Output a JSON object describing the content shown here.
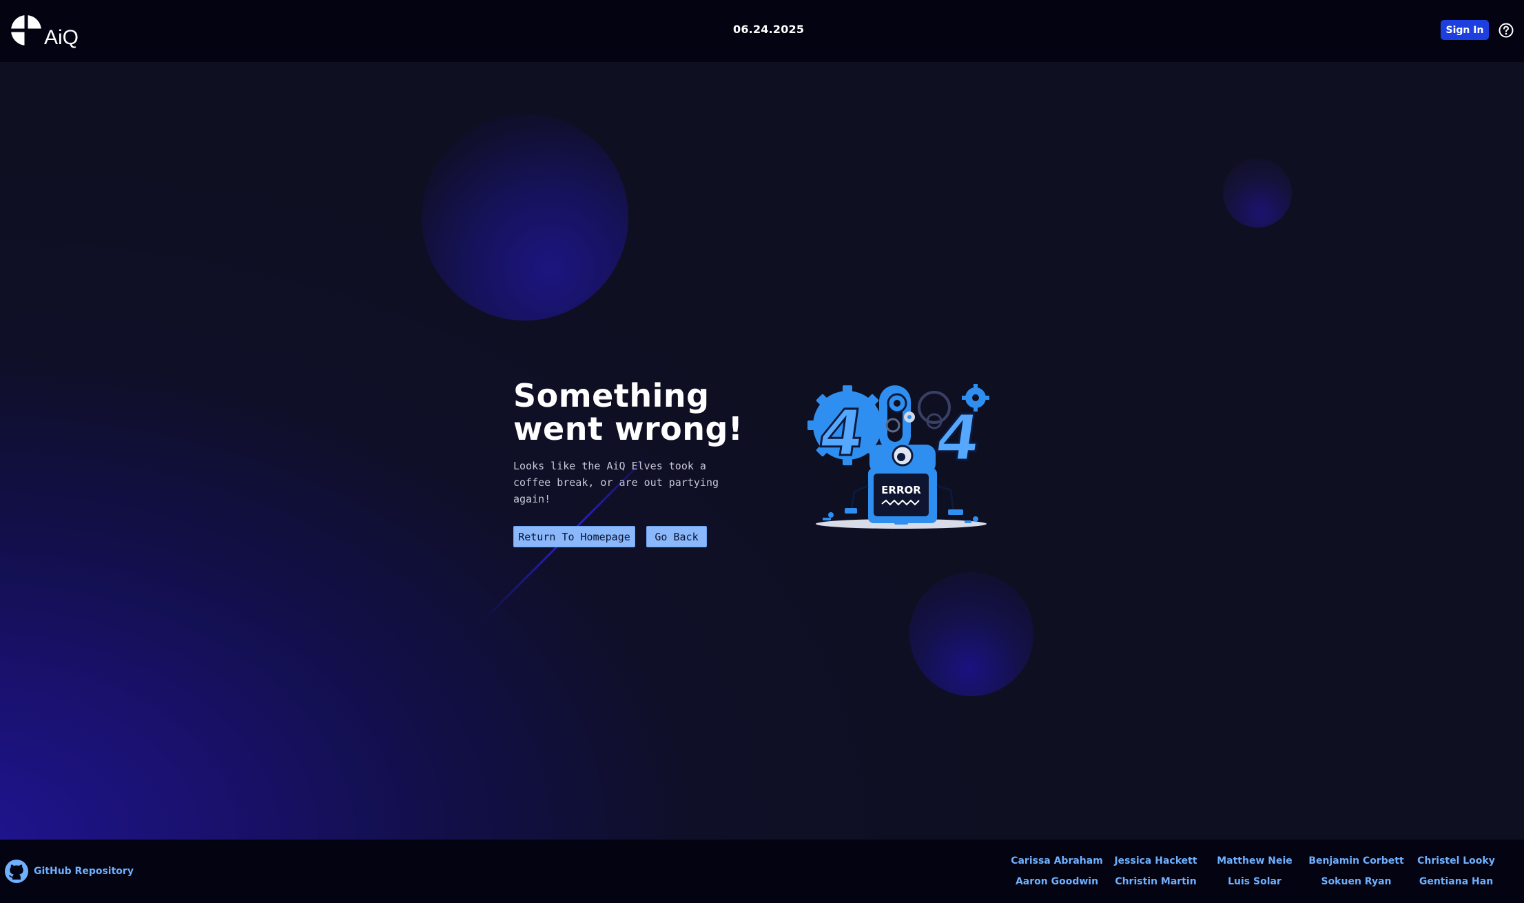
{
  "header": {
    "logo_text": "AiQ",
    "date": "06.24.2025",
    "signin_label": "Sign In",
    "help_icon": "question-circle-icon"
  },
  "main": {
    "headline_line1": "Something",
    "headline_line2": "went wrong!",
    "subtext": "Looks like the AiQ Elves took a coffee break, or are out partying again!",
    "buttons": {
      "home": "Return To Homepage",
      "back": "Go Back"
    },
    "illustration": {
      "code_digit_left": "4",
      "code_digit_right": "4",
      "error_label": "ERROR"
    }
  },
  "footer": {
    "github_label": "GitHub Repository",
    "github_icon": "github-icon",
    "credits": [
      "Carissa Abraham",
      "Jessica Hackett",
      "Matthew Neie",
      "Benjamin Corbett",
      "Christel Looky",
      "Aaron Goodwin",
      "Christin Martin",
      "Luis Solar",
      "Sokuen Ryan",
      "Gentiana Han"
    ]
  },
  "colors": {
    "header_bg": "#030312",
    "accent_blue": "#1d3fe0",
    "button_light_blue": "#8ab8fb",
    "link_blue": "#6fb0ff",
    "illustration_blue": "#2f8ff0"
  }
}
